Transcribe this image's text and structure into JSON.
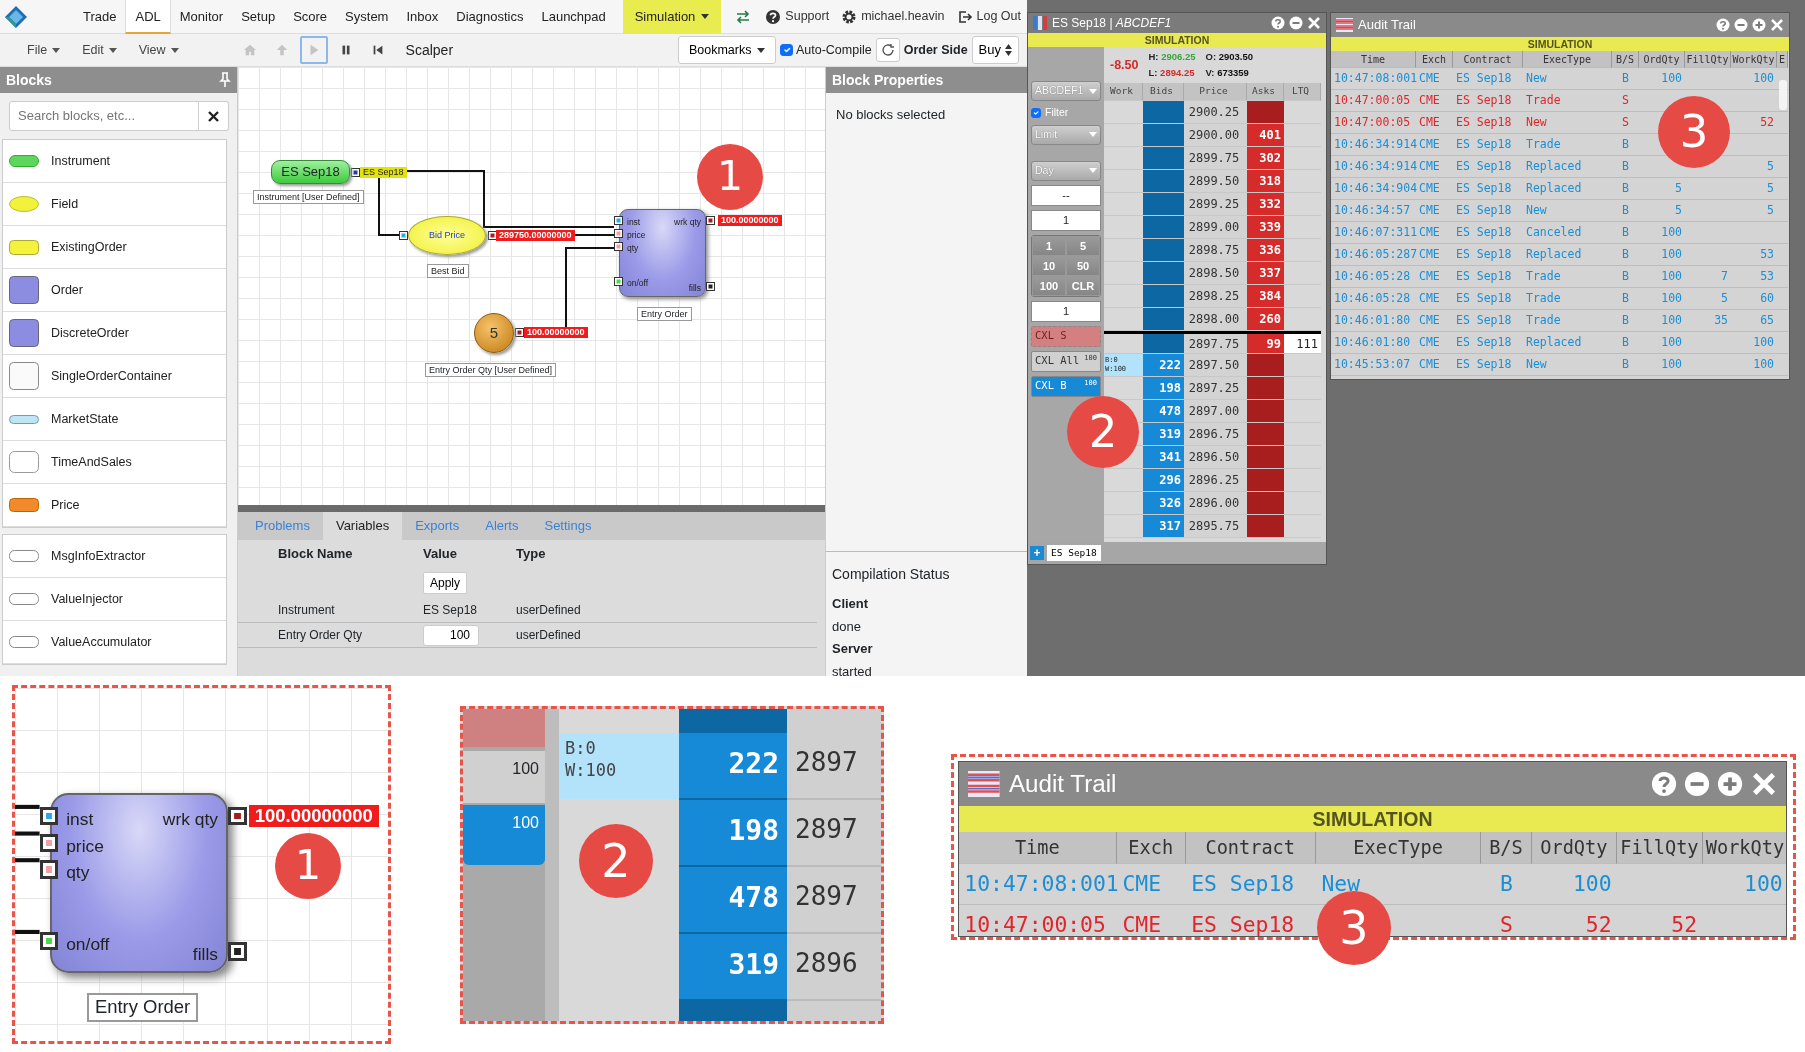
{
  "menu_bar": {
    "items": [
      {
        "label": "Trade",
        "selected": false
      },
      {
        "label": "ADL",
        "selected": true
      },
      {
        "label": "Monitor",
        "selected": false
      },
      {
        "label": "Setup",
        "selected": false
      },
      {
        "label": "Score",
        "selected": false
      },
      {
        "label": "System",
        "selected": false
      },
      {
        "label": "Inbox",
        "selected": false
      },
      {
        "label": "Diagnostics",
        "selected": false
      },
      {
        "label": "Launchpad",
        "selected": false
      }
    ],
    "mode": "Simulation",
    "links": [
      {
        "kind": "swap"
      },
      {
        "kind": "help",
        "label": "Support"
      },
      {
        "kind": "gear",
        "label": "michael.heavin"
      },
      {
        "kind": "logout",
        "label": "Log Out"
      }
    ]
  },
  "toolbar": {
    "menus": [
      "File",
      "Edit",
      "View"
    ],
    "buttons": [
      {
        "kind": "home",
        "disabled": true,
        "selected": false
      },
      {
        "kind": "up",
        "disabled": true,
        "selected": false
      },
      {
        "kind": "play",
        "disabled": true,
        "selected": true
      },
      {
        "kind": "pause",
        "disabled": false,
        "selected": false
      },
      {
        "kind": "restart",
        "disabled": false,
        "selected": false
      }
    ],
    "strategy": "Scalper",
    "bookmarks": "Bookmarks",
    "auto_compile": {
      "label": "Auto-Compile",
      "checked": true
    },
    "order_side": {
      "label": "Order Side",
      "value": "Buy"
    }
  },
  "blocks_panel": {
    "title": "Blocks",
    "search": {
      "placeholder": "Search blocks, etc..."
    },
    "groups": [
      [
        {
          "label": "Instrument",
          "kind": "instrument"
        },
        {
          "label": "Field",
          "kind": "field"
        },
        {
          "label": "ExistingOrder",
          "kind": "existing"
        },
        {
          "label": "Order",
          "kind": "order"
        },
        {
          "label": "DiscreteOrder",
          "kind": "order"
        },
        {
          "label": "SingleOrderContainer",
          "kind": "container"
        },
        {
          "label": "MarketState",
          "kind": "state"
        },
        {
          "label": "TimeAndSales",
          "kind": "box"
        },
        {
          "label": "Price",
          "kind": "price"
        }
      ],
      [
        {
          "label": "MsgInfoExtractor",
          "kind": "plain"
        },
        {
          "label": "ValueInjector",
          "kind": "plain"
        },
        {
          "label": "ValueAccumulator",
          "kind": "plain"
        }
      ]
    ]
  },
  "canvas": {
    "badge": "1",
    "nodes": [
      {
        "kind": "instrument",
        "label": "ES Sep18",
        "caption": "Instrument [User Defined]",
        "output": "ES Sep18"
      },
      {
        "kind": "field",
        "label": "Bid Price",
        "caption": "Best Bid",
        "output": "289750.00000000"
      },
      {
        "kind": "order",
        "caption": "Entry Order",
        "inputs": [
          "inst",
          "price",
          "qty",
          "on/off"
        ],
        "outputs": [
          {
            "label": "wrk qty",
            "value": "100.00000000"
          },
          {
            "label": "fills"
          }
        ]
      },
      {
        "kind": "constant",
        "label": "5",
        "caption": "Entry Order Qty [User Defined]",
        "output": "100.00000000"
      }
    ]
  },
  "bottom_panel": {
    "tabs": [
      {
        "label": "Problems",
        "selected": false
      },
      {
        "label": "Variables",
        "selected": true
      },
      {
        "label": "Exports",
        "selected": false
      },
      {
        "label": "Alerts",
        "selected": false
      },
      {
        "label": "Settings",
        "selected": false
      }
    ],
    "columns": [
      "Block Name",
      "Value",
      "Type"
    ],
    "apply": "Apply",
    "rows": [
      {
        "name": "Instrument",
        "value": "ES Sep18",
        "type": "userDefined",
        "kind": "text"
      },
      {
        "name": "Entry Order Qty",
        "value": "100",
        "type": "userDefined",
        "kind": "input"
      }
    ]
  },
  "block_properties": {
    "title": "Block Properties",
    "message": "No blocks selected"
  },
  "compilation_status": {
    "title": "Compilation Status",
    "items": [
      {
        "label": "Client",
        "value": "done"
      },
      {
        "label": "Server",
        "value": "started"
      }
    ]
  },
  "ladder_window": {
    "title": "ES Sep18 | *ABCDEF1*",
    "banner": "SIMULATION",
    "change": "-8.50",
    "badge": "2",
    "stats": [
      {
        "kind": "high",
        "label": "H:",
        "value": "2906.25"
      },
      {
        "kind": "open",
        "label": "O:",
        "value": "2903.50"
      },
      {
        "kind": "low",
        "label": "L:",
        "value": "2894.25"
      },
      {
        "kind": "volume",
        "label": "V:",
        "value": "673359"
      }
    ],
    "account": "ABCDEF1",
    "filter": {
      "label": "Filter",
      "checked": true
    },
    "order_type": "Limit",
    "time_in_force": "Day",
    "price_field": "--",
    "qty_field": "1",
    "qty_buttons": [
      "1",
      "5",
      "10",
      "50",
      "100",
      "CLR"
    ],
    "qty_field_2": "1",
    "cancel_buttons": [
      {
        "kind": "sell",
        "label": "CXL S",
        "disabled": true
      },
      {
        "kind": "all",
        "label": "CXL All",
        "count": "100",
        "disabled": false
      },
      {
        "kind": "buy",
        "label": "CXL B",
        "count": "100",
        "disabled": false
      }
    ],
    "columns": [
      "Work",
      "Bids",
      "Price",
      "Asks",
      "LTQ"
    ],
    "rows": [
      {
        "price": "2900.25"
      },
      {
        "price": "2900.00",
        "ask": "401"
      },
      {
        "price": "2899.75",
        "ask": "302"
      },
      {
        "price": "2899.50",
        "ask": "318"
      },
      {
        "price": "2899.25",
        "ask": "332"
      },
      {
        "price": "2899.00",
        "ask": "339"
      },
      {
        "price": "2898.75",
        "ask": "336"
      },
      {
        "price": "2898.50",
        "ask": "337"
      },
      {
        "price": "2898.25",
        "ask": "384"
      },
      {
        "price": "2898.00",
        "ask": "260"
      },
      {
        "price": "2897.75",
        "ask": "99",
        "ltq": "111"
      },
      {
        "price": "2897.50",
        "bid": "222",
        "work": "B:0\nW:100"
      },
      {
        "price": "2897.25",
        "bid": "198"
      },
      {
        "price": "2897.00",
        "bid": "478"
      },
      {
        "price": "2896.75",
        "bid": "319"
      },
      {
        "price": "2896.50",
        "bid": "341"
      },
      {
        "price": "2896.25",
        "bid": "296"
      },
      {
        "price": "2896.00",
        "bid": "326"
      },
      {
        "price": "2895.75",
        "bid": "317"
      }
    ],
    "add_tab": "+",
    "tab": "ES Sep18"
  },
  "audit_trail": {
    "title": "Audit Trail",
    "banner": "SIMULATION",
    "badge": "3",
    "columns": [
      "Time",
      "Exch",
      "Contract",
      "ExecType",
      "B/S",
      "OrdQty",
      "FillQty",
      "WorkQty",
      "E"
    ],
    "rows": [
      {
        "color": "#1a8fd6",
        "time": "10:47:08:001",
        "exch": "CME",
        "contract": "ES Sep18",
        "exec_type": "New",
        "side": "B",
        "ord_qty": "100",
        "work_qty": "100"
      },
      {
        "color": "#e0262c",
        "time": "10:47:00:05",
        "exch": "CME",
        "contract": "ES Sep18",
        "exec_type": "Trade",
        "side": "S"
      },
      {
        "color": "#e0262c",
        "time": "10:47:00:05",
        "exch": "CME",
        "contract": "ES Sep18",
        "exec_type": "New",
        "side": "S",
        "work_qty": "52"
      },
      {
        "color": "#1a8fd6",
        "time": "10:46:34:914",
        "exch": "CME",
        "contract": "ES Sep18",
        "exec_type": "Trade",
        "side": "B"
      },
      {
        "color": "#1a8fd6",
        "time": "10:46:34:914",
        "exch": "CME",
        "contract": "ES Sep18",
        "exec_type": "Replaced",
        "side": "B",
        "work_qty": "5"
      },
      {
        "color": "#1a8fd6",
        "time": "10:46:34:904",
        "exch": "CME",
        "contract": "ES Sep18",
        "exec_type": "Replaced",
        "side": "B",
        "ord_qty": "5",
        "work_qty": "5"
      },
      {
        "color": "#1a8fd6",
        "time": "10:46:34:57",
        "exch": "CME",
        "contract": "ES Sep18",
        "exec_type": "New",
        "side": "B",
        "ord_qty": "5",
        "work_qty": "5"
      },
      {
        "color": "#1a8fd6",
        "time": "10:46:07:311",
        "exch": "CME",
        "contract": "ES Sep18",
        "exec_type": "Canceled",
        "side": "B",
        "ord_qty": "100"
      },
      {
        "color": "#1a8fd6",
        "time": "10:46:05:287",
        "exch": "CME",
        "contract": "ES Sep18",
        "exec_type": "Replaced",
        "side": "B",
        "ord_qty": "100",
        "work_qty": "53"
      },
      {
        "color": "#1a8fd6",
        "time": "10:46:05:28",
        "exch": "CME",
        "contract": "ES Sep18",
        "exec_type": "Trade",
        "side": "B",
        "ord_qty": "100",
        "fill_qty": "7",
        "work_qty": "53"
      },
      {
        "color": "#1a8fd6",
        "time": "10:46:05:28",
        "exch": "CME",
        "contract": "ES Sep18",
        "exec_type": "Trade",
        "side": "B",
        "ord_qty": "100",
        "fill_qty": "5",
        "work_qty": "60"
      },
      {
        "color": "#1a8fd6",
        "time": "10:46:01:80",
        "exch": "CME",
        "contract": "ES Sep18",
        "exec_type": "Trade",
        "side": "B",
        "ord_qty": "100",
        "fill_qty": "35",
        "work_qty": "65"
      },
      {
        "color": "#1a8fd6",
        "time": "10:46:01:80",
        "exch": "CME",
        "contract": "ES Sep18",
        "exec_type": "Replaced",
        "side": "B",
        "ord_qty": "100",
        "work_qty": "100"
      },
      {
        "color": "#1a8fd6",
        "time": "10:45:53:07",
        "exch": "CME",
        "contract": "ES Sep18",
        "exec_type": "New",
        "side": "B",
        "ord_qty": "100",
        "work_qty": "100"
      }
    ]
  },
  "insets": {
    "order": {
      "badge": "1",
      "caption": "Entry Order",
      "inputs": [
        "inst",
        "price",
        "qty",
        "on/off"
      ],
      "outputs": [
        {
          "label": "wrk qty",
          "value": "100.00000000"
        },
        {
          "label": "fills"
        }
      ]
    },
    "ladder": {
      "badge": "2",
      "cancel_all_count": "100",
      "cancel_buy_count": "100",
      "work": "B:0\nW:100",
      "rows": [
        {
          "bid": "222",
          "price": "2897"
        },
        {
          "bid": "198",
          "price": "2897"
        },
        {
          "bid": "478",
          "price": "2897"
        },
        {
          "bid": "319",
          "price": "2896"
        }
      ]
    },
    "audit": {
      "badge": "3",
      "title": "Audit Trail",
      "banner": "SIMULATION",
      "columns": [
        "Time",
        "Exch",
        "Contract",
        "ExecType",
        "B/S",
        "OrdQty",
        "FillQty",
        "WorkQty"
      ],
      "rows": [
        {
          "color": "#1a8fd6",
          "time": "10:47:08:001",
          "exch": "CME",
          "contract": "ES Sep18",
          "exec_type": "New",
          "side": "B",
          "ord_qty": "100",
          "work_qty": "100"
        },
        {
          "color": "#e0262c",
          "time": "10:47:00:05",
          "exch": "CME",
          "contract": "ES Sep18",
          "side": "S",
          "ord_qty": "52",
          "fill_qty": "52"
        }
      ]
    }
  }
}
